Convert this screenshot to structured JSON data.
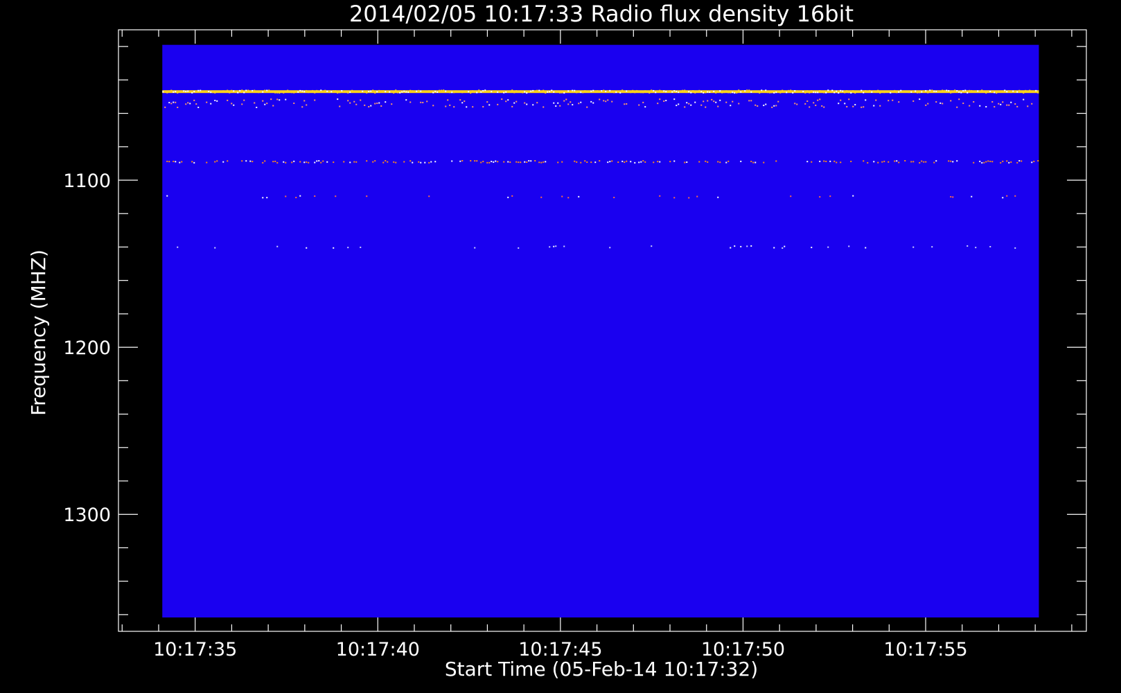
{
  "chart_data": {
    "type": "heatmap",
    "title": "2014/02/05 10:17:33 Radio flux density 16bit",
    "xlabel": "Start Time (05-Feb-14 10:17:32)",
    "ylabel": "Frequency (MHZ)",
    "x_tick_labels": [
      "10:17:35",
      "10:17:40",
      "10:17:45",
      "10:17:50",
      "10:17:55"
    ],
    "x_tick_values_s": [
      35,
      40,
      45,
      50,
      55
    ],
    "xlim_s": [
      32.9,
      59.4
    ],
    "x_data_range_s": [
      34.1,
      58.1
    ],
    "y_tick_labels": [
      "1100",
      "1200",
      "1300"
    ],
    "y_tick_values": [
      1100,
      1200,
      1300
    ],
    "ylim": [
      1010,
      1370
    ],
    "y_data_range": [
      1019,
      1385
    ],
    "background_color": "#1a00f0",
    "emission_bands_mhz": [
      {
        "freq": 1047,
        "intensity": "high",
        "color": "#ffd21a"
      },
      {
        "freq": 1054,
        "intensity": "medium",
        "color": "#ff9a6a"
      },
      {
        "freq": 1089,
        "intensity": "medium",
        "color": "#ff8a1a"
      },
      {
        "freq": 1110,
        "intensity": "low",
        "color": "#ff6a4a"
      },
      {
        "freq": 1140,
        "intensity": "low",
        "color": "#d0d0ff"
      }
    ],
    "grid": false,
    "legend": "none"
  }
}
